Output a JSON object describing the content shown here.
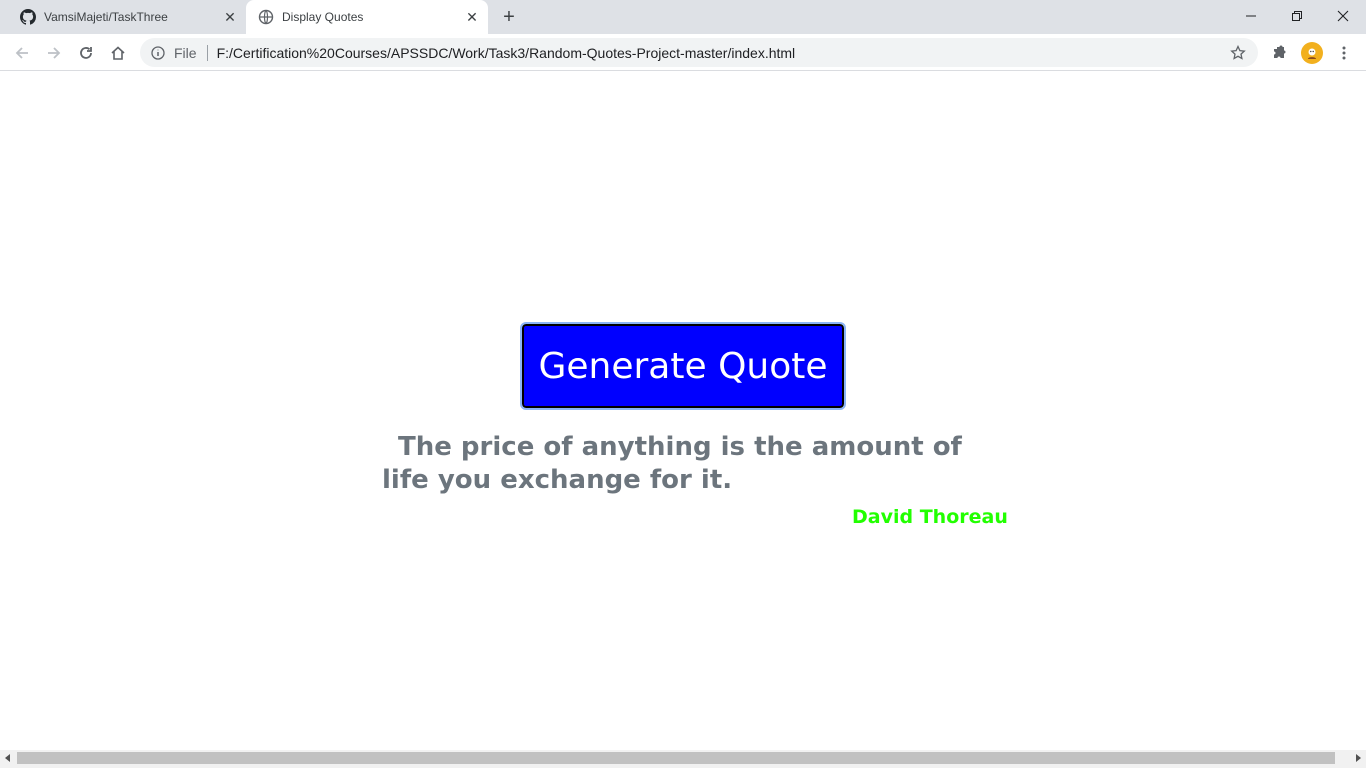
{
  "tabs": [
    {
      "title": "VamsiMajeti/TaskThree",
      "icon": "github-icon"
    },
    {
      "title": "Display Quotes",
      "icon": "globe-icon"
    }
  ],
  "window_controls": {
    "minimize": "minimize-icon",
    "maximize": "restore-icon",
    "close": "close-icon"
  },
  "omnibox": {
    "scheme": "File",
    "url": "F:/Certification%20Courses/APSSDC/Work/Task3/Random-Quotes-Project-master/index.html"
  },
  "page": {
    "button_label": "Generate Quote",
    "quote": "The price of anything is the amount of life you exchange for it.",
    "author": "David Thoreau",
    "colors": {
      "button_bg": "#0000ff",
      "quote_text": "#6c757d",
      "author_text": "#22ff00"
    }
  }
}
